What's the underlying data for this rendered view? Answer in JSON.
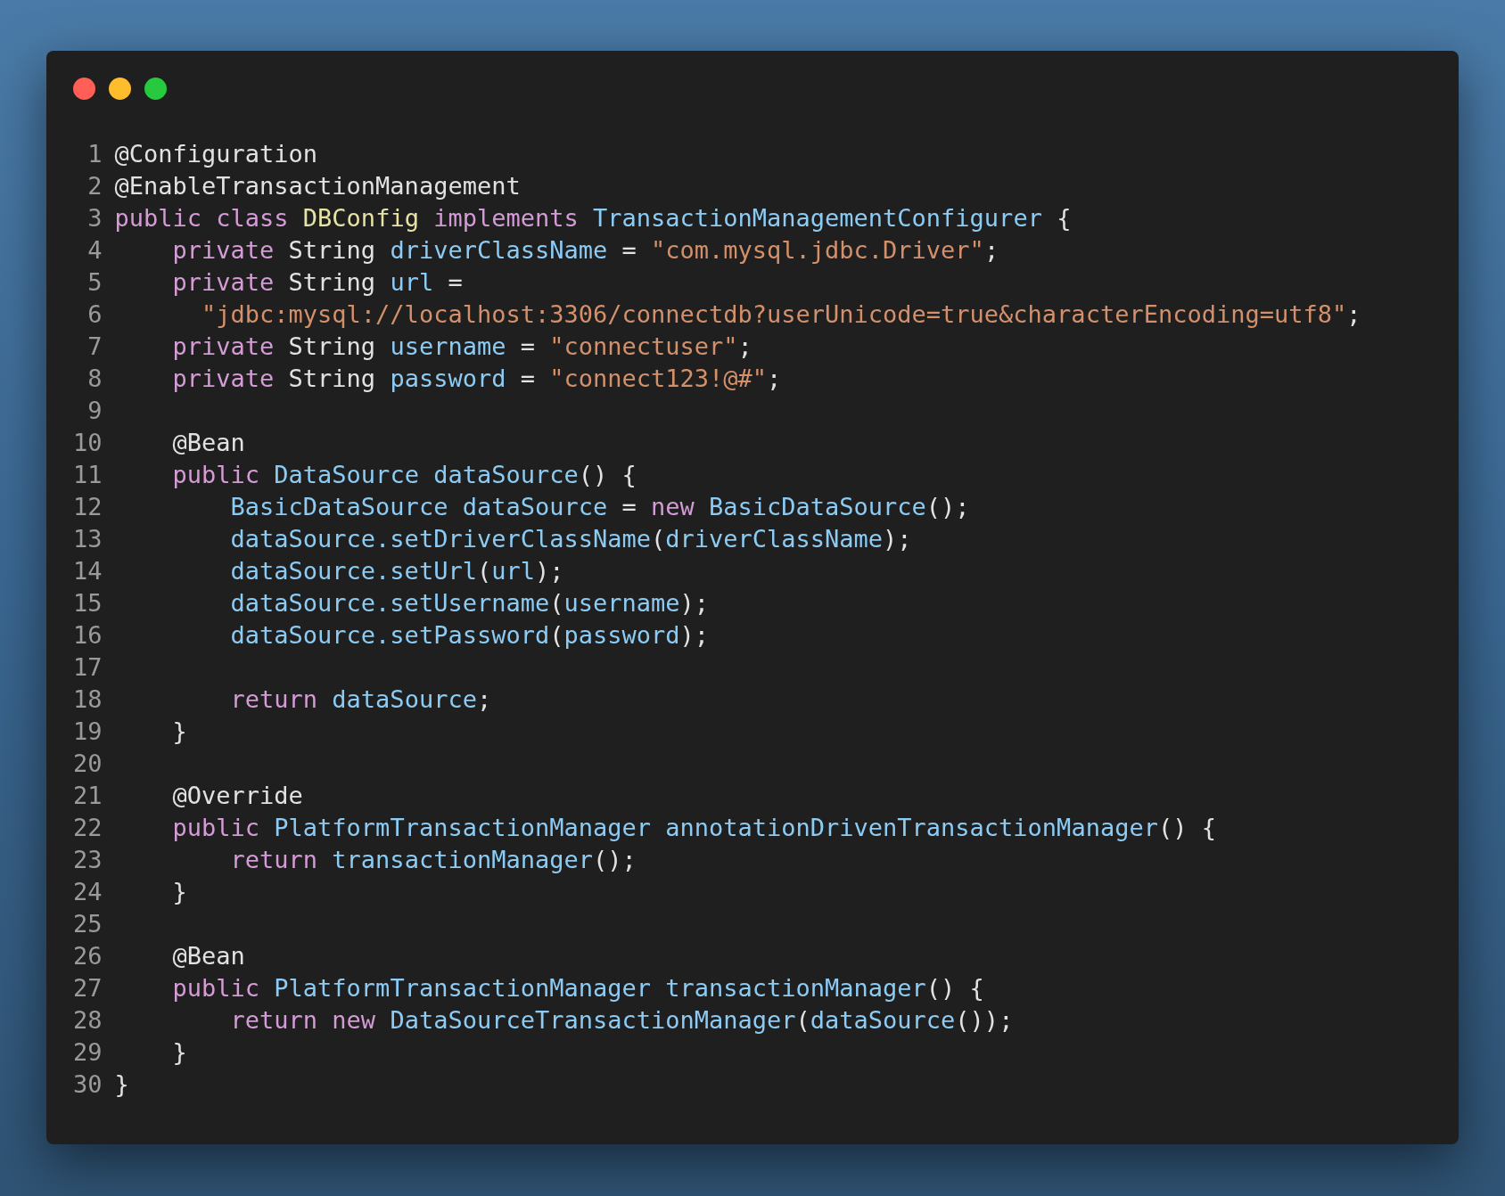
{
  "editor": {
    "lines": [
      {
        "number": "1",
        "tokens": [
          {
            "text": "@Configuration",
            "kind": "plain"
          }
        ]
      },
      {
        "number": "2",
        "tokens": [
          {
            "text": "@EnableTransactionManagement",
            "kind": "plain"
          }
        ]
      },
      {
        "number": "3",
        "tokens": [
          {
            "text": "public class",
            "kind": "keyword"
          },
          {
            "text": " DBConfig",
            "kind": "classname"
          },
          {
            "text": " implements",
            "kind": "keyword"
          },
          {
            "text": " TransactionManagementConfigurer",
            "kind": "ident"
          },
          {
            "text": " {",
            "kind": "plain"
          }
        ]
      },
      {
        "number": "4",
        "tokens": [
          {
            "text": "    private",
            "kind": "keyword"
          },
          {
            "text": " String",
            "kind": "plain"
          },
          {
            "text": " driverClassName",
            "kind": "ident"
          },
          {
            "text": " = ",
            "kind": "plain"
          },
          {
            "text": "\"com.mysql.jdbc.Driver\"",
            "kind": "string"
          },
          {
            "text": ";",
            "kind": "plain"
          }
        ]
      },
      {
        "number": "5",
        "tokens": [
          {
            "text": "    private",
            "kind": "keyword"
          },
          {
            "text": " String",
            "kind": "plain"
          },
          {
            "text": " url",
            "kind": "ident"
          },
          {
            "text": " =",
            "kind": "plain"
          }
        ]
      },
      {
        "number": "6",
        "tokens": [
          {
            "text": "      \"jdbc:mysql://localhost:3306/connectdb?userUnicode=true&characterEncoding=utf8\"",
            "kind": "string"
          },
          {
            "text": ";",
            "kind": "plain"
          }
        ]
      },
      {
        "number": "7",
        "tokens": [
          {
            "text": "    private",
            "kind": "keyword"
          },
          {
            "text": " String",
            "kind": "plain"
          },
          {
            "text": " username",
            "kind": "ident"
          },
          {
            "text": " = ",
            "kind": "plain"
          },
          {
            "text": "\"connectuser\"",
            "kind": "string"
          },
          {
            "text": ";",
            "kind": "plain"
          }
        ]
      },
      {
        "number": "8",
        "tokens": [
          {
            "text": "    private",
            "kind": "keyword"
          },
          {
            "text": " String",
            "kind": "plain"
          },
          {
            "text": " password",
            "kind": "ident"
          },
          {
            "text": " = ",
            "kind": "plain"
          },
          {
            "text": "\"connect123!@#\"",
            "kind": "string"
          },
          {
            "text": ";",
            "kind": "plain"
          }
        ]
      },
      {
        "number": "9"
      },
      {
        "number": "10",
        "tokens": [
          {
            "text": "    @Bean",
            "kind": "plain"
          }
        ]
      },
      {
        "number": "11",
        "tokens": [
          {
            "text": "    public",
            "kind": "keyword"
          },
          {
            "text": " DataSource dataSource",
            "kind": "ident"
          },
          {
            "text": "() {",
            "kind": "plain"
          }
        ]
      },
      {
        "number": "12",
        "tokens": [
          {
            "text": "        BasicDataSource dataSource",
            "kind": "ident"
          },
          {
            "text": " = ",
            "kind": "plain"
          },
          {
            "text": "new",
            "kind": "keyword"
          },
          {
            "text": " BasicDataSource",
            "kind": "ident"
          },
          {
            "text": "();",
            "kind": "plain"
          }
        ]
      },
      {
        "number": "13",
        "tokens": [
          {
            "text": "        dataSource.setDriverClassName",
            "kind": "ident"
          },
          {
            "text": "(",
            "kind": "plain"
          },
          {
            "text": "driverClassName",
            "kind": "ident"
          },
          {
            "text": ");",
            "kind": "plain"
          }
        ]
      },
      {
        "number": "14",
        "tokens": [
          {
            "text": "        dataSource.setUrl",
            "kind": "ident"
          },
          {
            "text": "(",
            "kind": "plain"
          },
          {
            "text": "url",
            "kind": "ident"
          },
          {
            "text": ");",
            "kind": "plain"
          }
        ]
      },
      {
        "number": "15",
        "tokens": [
          {
            "text": "        dataSource.setUsername",
            "kind": "ident"
          },
          {
            "text": "(",
            "kind": "plain"
          },
          {
            "text": "username",
            "kind": "ident"
          },
          {
            "text": ");",
            "kind": "plain"
          }
        ]
      },
      {
        "number": "16",
        "tokens": [
          {
            "text": "        dataSource.setPassword",
            "kind": "ident"
          },
          {
            "text": "(",
            "kind": "plain"
          },
          {
            "text": "password",
            "kind": "ident"
          },
          {
            "text": ");",
            "kind": "plain"
          }
        ]
      },
      {
        "number": "17"
      },
      {
        "number": "18",
        "tokens": [
          {
            "text": "        return",
            "kind": "keyword"
          },
          {
            "text": " dataSource",
            "kind": "ident"
          },
          {
            "text": ";",
            "kind": "plain"
          }
        ]
      },
      {
        "number": "19",
        "tokens": [
          {
            "text": "    }",
            "kind": "plain"
          }
        ]
      },
      {
        "number": "20"
      },
      {
        "number": "21",
        "tokens": [
          {
            "text": "    @Override",
            "kind": "plain"
          }
        ]
      },
      {
        "number": "22",
        "tokens": [
          {
            "text": "    public",
            "kind": "keyword"
          },
          {
            "text": " PlatformTransactionManager annotationDrivenTransactionManager",
            "kind": "ident"
          },
          {
            "text": "() {",
            "kind": "plain"
          }
        ]
      },
      {
        "number": "23",
        "tokens": [
          {
            "text": "        return",
            "kind": "keyword"
          },
          {
            "text": " transactionManager",
            "kind": "ident"
          },
          {
            "text": "();",
            "kind": "plain"
          }
        ]
      },
      {
        "number": "24",
        "tokens": [
          {
            "text": "    }",
            "kind": "plain"
          }
        ]
      },
      {
        "number": "25"
      },
      {
        "number": "26",
        "tokens": [
          {
            "text": "    @Bean",
            "kind": "plain"
          }
        ]
      },
      {
        "number": "27",
        "tokens": [
          {
            "text": "    public",
            "kind": "keyword"
          },
          {
            "text": " PlatformTransactionManager transactionManager",
            "kind": "ident"
          },
          {
            "text": "() {",
            "kind": "plain"
          }
        ]
      },
      {
        "number": "28",
        "tokens": [
          {
            "text": "        return new",
            "kind": "keyword"
          },
          {
            "text": " DataSourceTransactionManager",
            "kind": "ident"
          },
          {
            "text": "(",
            "kind": "plain"
          },
          {
            "text": "dataSource",
            "kind": "ident"
          },
          {
            "text": "());",
            "kind": "plain"
          }
        ]
      },
      {
        "number": "29",
        "tokens": [
          {
            "text": "    }",
            "kind": "plain"
          }
        ]
      },
      {
        "number": "30",
        "tokens": [
          {
            "text": "}",
            "kind": "plain"
          }
        ]
      }
    ]
  }
}
